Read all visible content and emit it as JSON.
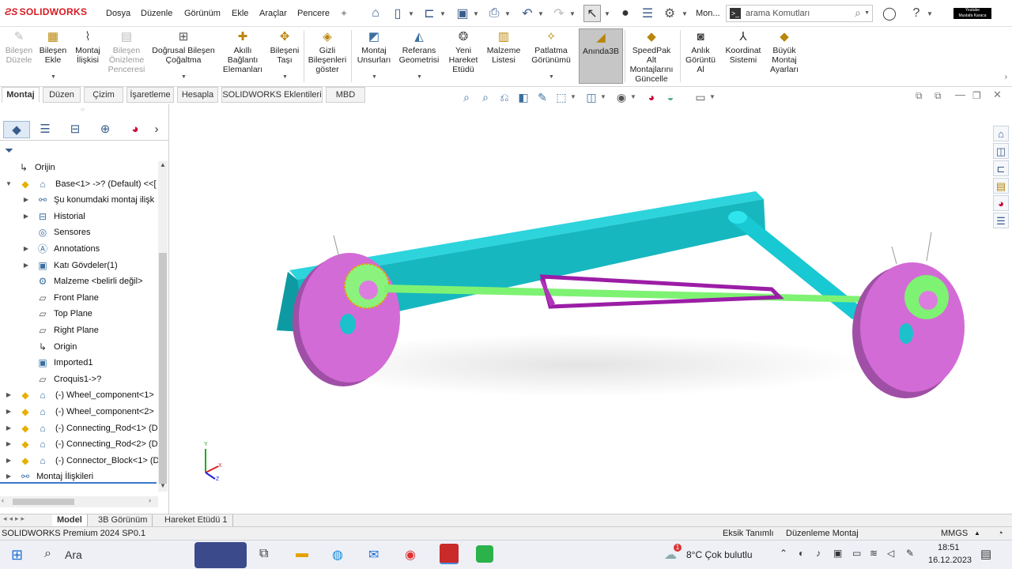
{
  "app": {
    "brand": "SOLIDWORKS",
    "version_status": "SOLIDWORKS Premium 2024 SP0.1"
  },
  "menu": [
    "Dosya",
    "Düzenle",
    "Görünüm",
    "Ekle",
    "Araçlar",
    "Pencere"
  ],
  "toolbar_extra": {
    "mon_label": "Mon...",
    "search_placeholder": "arama Komutları"
  },
  "ribbon": [
    {
      "label": "Bileşen\nDüzele",
      "disabled": true
    },
    {
      "label": "Bileşen\nEkle"
    },
    {
      "label": "Montaj\nİlişkisi"
    },
    {
      "label": "Bileşen\nÖnizleme\nPenceresi",
      "disabled": true
    },
    {
      "label": "Doğrusal Bileşen\nÇoğaltma"
    },
    {
      "label": "Akıllı\nBağlantı\nElemanları"
    },
    {
      "label": "Bileşeni\nTaşı"
    },
    {
      "label": "Gizli\nBileşenleri\ngöster"
    },
    {
      "label": "Montaj\nUnsurları"
    },
    {
      "label": "Referans\nGeometrisi"
    },
    {
      "label": "Yeni\nHareket\nEtüdü"
    },
    {
      "label": "Malzeme\nListesi"
    },
    {
      "label": "Patlatma\nGörünümü"
    },
    {
      "label": "Anında3B",
      "active": true
    },
    {
      "label": "SpeedPak\nAlt\nMontajlarını\nGüncelle"
    },
    {
      "label": "Anlık\nGörüntü\nAl"
    },
    {
      "label": "Koordinat\nSistemi"
    },
    {
      "label": "Büyük\nMontaj\nAyarları"
    }
  ],
  "tabs": [
    "Montaj",
    "Düzen",
    "Çizim",
    "İşaretleme",
    "Hesapla",
    "SOLIDWORKS Eklentileri",
    "MBD"
  ],
  "active_tab": "Montaj",
  "tree": [
    {
      "label": "Orijin",
      "indent": 1,
      "icon": "origin-icon",
      "toggle": ""
    },
    {
      "label": "Base<1> ->? (Default) <<[",
      "indent": 0,
      "icon": "part-icon",
      "toggle": "▼"
    },
    {
      "label": "Şu konumdaki montaj ilişk",
      "indent": 1,
      "icon": "mate-icon",
      "toggle": "▶"
    },
    {
      "label": "Historial",
      "indent": 1,
      "icon": "history-icon",
      "toggle": "▶"
    },
    {
      "label": "Sensores",
      "indent": 1,
      "icon": "sensor-icon",
      "toggle": ""
    },
    {
      "label": "Annotations",
      "indent": 1,
      "icon": "annotation-icon",
      "toggle": "▶"
    },
    {
      "label": "Katı Gövdeler(1)",
      "indent": 1,
      "icon": "solid-bodies-icon",
      "toggle": "▶"
    },
    {
      "label": "Malzeme <belirli değil>",
      "indent": 1,
      "icon": "material-icon",
      "toggle": ""
    },
    {
      "label": "Front Plane",
      "indent": 1,
      "icon": "plane-icon",
      "toggle": ""
    },
    {
      "label": "Top Plane",
      "indent": 1,
      "icon": "plane-icon",
      "toggle": ""
    },
    {
      "label": "Right Plane",
      "indent": 1,
      "icon": "plane-icon",
      "toggle": ""
    },
    {
      "label": "Origin",
      "indent": 1,
      "icon": "origin-icon",
      "toggle": ""
    },
    {
      "label": "Imported1",
      "indent": 1,
      "icon": "imported-icon",
      "toggle": ""
    },
    {
      "label": "Croquis1->?",
      "indent": 1,
      "icon": "sketch-icon",
      "toggle": ""
    },
    {
      "label": "(-) Wheel_component<1>",
      "indent": 0,
      "icon": "part-icon",
      "toggle": "▶"
    },
    {
      "label": "(-) Wheel_component<2>",
      "indent": 0,
      "icon": "part-icon",
      "toggle": "▶"
    },
    {
      "label": "(-) Connecting_Rod<1> (D",
      "indent": 0,
      "icon": "part-icon",
      "toggle": "▶"
    },
    {
      "label": "(-) Connecting_Rod<2> (D",
      "indent": 0,
      "icon": "part-icon",
      "toggle": "▶"
    },
    {
      "label": "(-) Connector_Block<1> (D",
      "indent": 0,
      "icon": "part-icon",
      "toggle": "▶"
    },
    {
      "label": "Montaj İlişkileri",
      "indent": -1,
      "icon": "mates-folder-icon",
      "toggle": "▶"
    }
  ],
  "bottom_tabs": [
    "Model",
    "3B Görünüm",
    "Hareket Etüdü 1"
  ],
  "status": {
    "left": "SOLIDWORKS Premium 2024 SP0.1",
    "mid1": "Eksik Tanımlı",
    "mid2": "Düzenleme Montaj",
    "units": "MMGS"
  },
  "taskbar": {
    "search": "Ara",
    "weather": "8°C  Çok bulutlu",
    "weather_badge": "1",
    "time": "18:51",
    "date": "16.12.2023"
  },
  "yt_badge": "Youtube\nMustafa Karaca",
  "triad": {
    "x": "X",
    "y": "Y",
    "z": "Z"
  },
  "colors": {
    "accent": "#d71920",
    "active_button": "#c6c6c6",
    "selection_blue": "#dfeaf6"
  }
}
